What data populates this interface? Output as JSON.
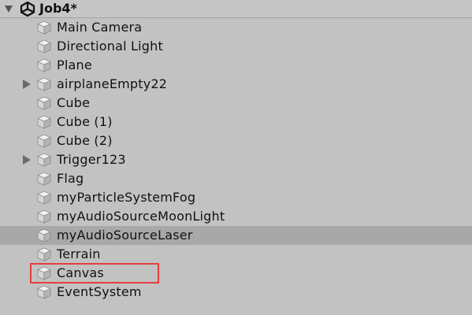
{
  "hierarchy": {
    "scene_name": "Job4*",
    "icons": {
      "scene": "unity-logo-icon",
      "object": "gameobject-cube-icon",
      "expand": "triangle-right-icon",
      "collapse": "triangle-down-icon"
    },
    "colors": {
      "background": "#c2c2c2",
      "selected_row": "#a8a8a8",
      "annotation": "#e53e3e"
    },
    "items": [
      {
        "label": "Main Camera",
        "has_children": false,
        "selected": false
      },
      {
        "label": "Directional Light",
        "has_children": false,
        "selected": false
      },
      {
        "label": "Plane",
        "has_children": false,
        "selected": false
      },
      {
        "label": "airplaneEmpty22",
        "has_children": true,
        "selected": false
      },
      {
        "label": "Cube",
        "has_children": false,
        "selected": false
      },
      {
        "label": "Cube (1)",
        "has_children": false,
        "selected": false
      },
      {
        "label": "Cube (2)",
        "has_children": false,
        "selected": false
      },
      {
        "label": "Trigger123",
        "has_children": true,
        "selected": false
      },
      {
        "label": "Flag",
        "has_children": false,
        "selected": false
      },
      {
        "label": "myParticleSystemFog",
        "has_children": false,
        "selected": false
      },
      {
        "label": "myAudioSourceMoonLight",
        "has_children": false,
        "selected": false
      },
      {
        "label": "myAudioSourceLaser",
        "has_children": false,
        "selected": true
      },
      {
        "label": "Terrain",
        "has_children": false,
        "selected": false
      },
      {
        "label": "Canvas",
        "has_children": false,
        "selected": false,
        "annotated": true
      },
      {
        "label": "EventSystem",
        "has_children": false,
        "selected": false
      }
    ]
  }
}
